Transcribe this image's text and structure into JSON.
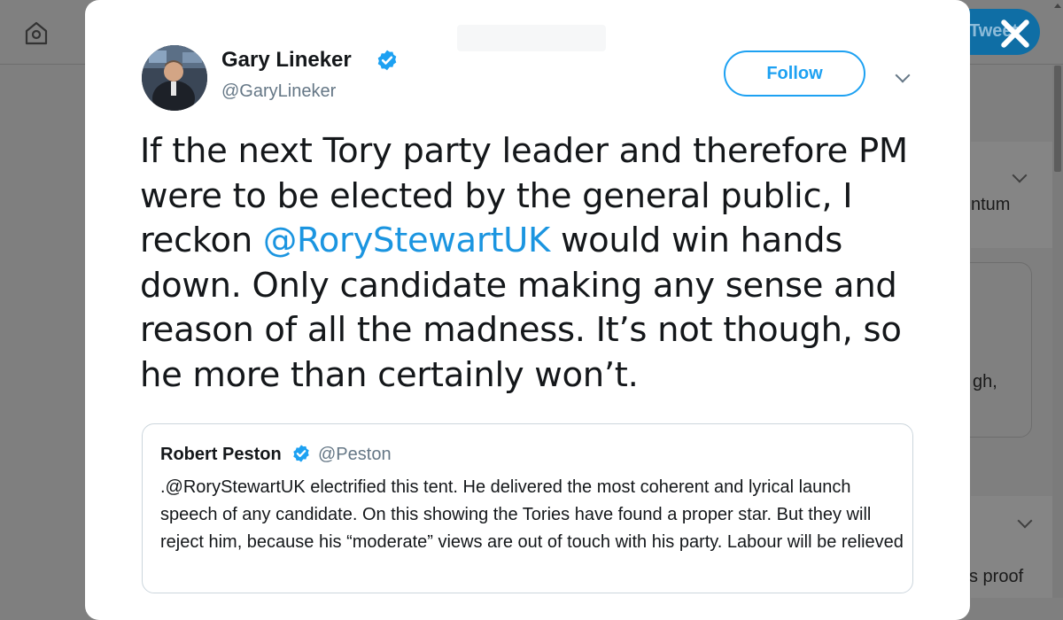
{
  "background": {
    "tweet_button_label": "Tweet",
    "fragments": [
      "ntum",
      "gh,",
      "s proof"
    ]
  },
  "tweet": {
    "author_name": "Gary Lineker",
    "author_handle": "@GaryLineker",
    "follow_label": "Follow",
    "text_before_mention": "If the next Tory party leader and therefore PM were to be elected by the general public, I reckon ",
    "mention": "@RoryStewartUK",
    "text_after_mention": " would win hands down. Only candidate making any sense and reason of all the madness. It’s not though, so he more than certainly won’t."
  },
  "quoted_tweet": {
    "author_name": "Robert Peston",
    "author_handle": "@Peston",
    "text": ".@RoryStewartUK electrified this tent.  He delivered the most coherent and lyrical launch speech of any candidate. On this showing the Tories have found a proper star. But they will reject him, because his “moderate” views are out of touch with his party. Labour will be relieved"
  },
  "colors": {
    "accent": "#1da1f2",
    "mention": "#1b95e0",
    "overlay": "#7f7f7f"
  },
  "icons": [
    "home-icon",
    "verified-badge-icon",
    "chevron-down-icon",
    "close-icon"
  ]
}
